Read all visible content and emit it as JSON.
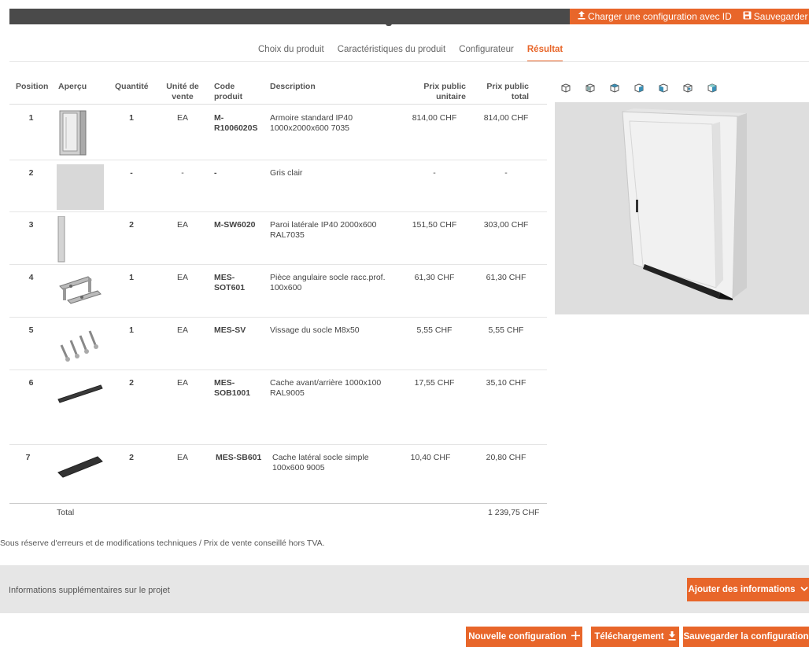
{
  "topbar": {
    "load_label": "Charger une configuration avec ID",
    "save_label": "Sauvegarder"
  },
  "tabs": [
    {
      "label": "Choix du produit"
    },
    {
      "label": "Caractéristiques du produit"
    },
    {
      "label": "Configurateur"
    },
    {
      "label": "Résultat",
      "active": true
    }
  ],
  "table": {
    "headers": {
      "position": "Position",
      "apercu": "Aperçu",
      "quantite": "Quantité",
      "unite_l1": "Unité de",
      "unite_l2": "vente",
      "code_l1": "Code",
      "code_l2": "produit",
      "description": "Description",
      "pu_l1": "Prix public",
      "pu_l2": "unitaire",
      "pt_l1": "Prix public",
      "pt_l2": "total"
    },
    "rows": [
      {
        "position": "1",
        "quantite": "1",
        "unite": "EA",
        "code": "M-R1006020S",
        "description": "Armoire standard IP40 1000x2000x600 7035",
        "prix_unitaire": "814,00 CHF",
        "prix_total": "814,00 CHF",
        "preview_icon": "cabinet-icon"
      },
      {
        "position": "2",
        "quantite": "-",
        "unite": "-",
        "code": "-",
        "description": "Gris clair",
        "prix_unitaire": "-",
        "prix_total": "-",
        "preview_icon": "color-swatch-icon"
      },
      {
        "position": "3",
        "quantite": "2",
        "unite": "EA",
        "code": "M-SW6020",
        "description": "Paroi latérale IP40 2000x600 RAL7035",
        "prix_unitaire": "151,50 CHF",
        "prix_total": "303,00 CHF",
        "preview_icon": "side-panel-icon"
      },
      {
        "position": "4",
        "quantite": "1",
        "unite": "EA",
        "code": "MES-SOT601",
        "description": "Pièce angulaire socle racc.prof. 100x600",
        "prix_unitaire": "61,30 CHF",
        "prix_total": "61,30 CHF",
        "preview_icon": "corner-piece-icon"
      },
      {
        "position": "5",
        "quantite": "1",
        "unite": "EA",
        "code": "MES-SV",
        "description": "Vissage du socle M8x50",
        "prix_unitaire": "5,55 CHF",
        "prix_total": "5,55 CHF",
        "preview_icon": "screws-icon"
      },
      {
        "position": "6",
        "quantite": "2",
        "unite": "EA",
        "code": "MES-SOB1001",
        "description": "Cache avant/arrière 1000x100 RAL9005",
        "prix_unitaire": "17,55 CHF",
        "prix_total": "35,10 CHF",
        "preview_icon": "base-cover-icon"
      },
      {
        "position": "7",
        "quantite": "2",
        "unite": "EA",
        "code": "MES-SB601",
        "description": "Cache latéral socle simple 100x600 9005",
        "prix_unitaire": "10,40 CHF",
        "prix_total": "20,80 CHF",
        "preview_icon": "side-cover-icon"
      }
    ],
    "total_label": "Total",
    "total_value": "1 239,75 CHF"
  },
  "disclaimer": "Sous réserve d'erreurs et de modifications techniques / Prix de vente conseillé hors TVA.",
  "info": {
    "label": "Informations supplémentaires sur le projet",
    "add_button": "Ajouter des informations"
  },
  "buttons": {
    "new_config": "Nouvelle configuration",
    "download": "Téléchargement",
    "save_config": "Sauvegarder la configuration"
  },
  "colors": {
    "accent": "#e8662a",
    "topbar": "#4a4a4a",
    "panel": "#e6e6e6"
  }
}
